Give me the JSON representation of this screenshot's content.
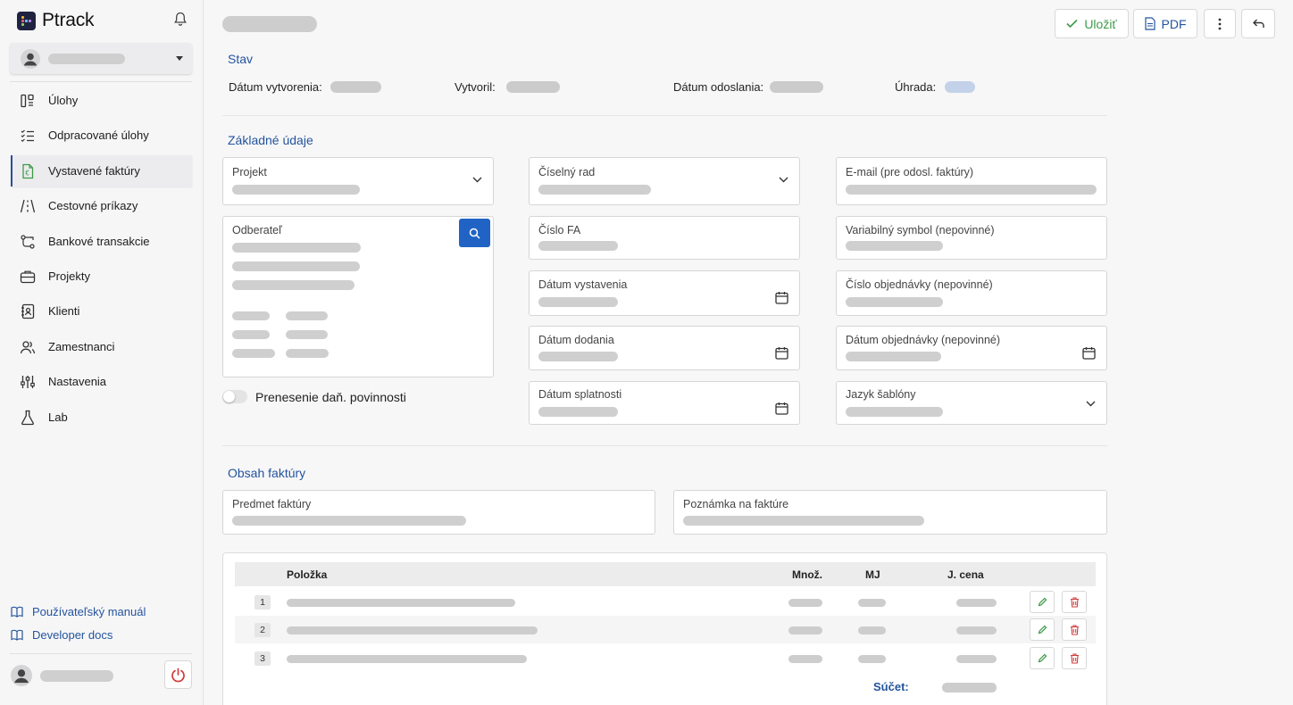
{
  "app": {
    "name": "Ptrack"
  },
  "sidebar": {
    "items": [
      {
        "label": "Úlohy",
        "icon": "tasks-icon"
      },
      {
        "label": "Odpracované úlohy",
        "icon": "checklist-icon"
      },
      {
        "label": "Vystavené faktúry",
        "icon": "invoice-icon",
        "active": true
      },
      {
        "label": "Cestovné príkazy",
        "icon": "road-icon"
      },
      {
        "label": "Bankové transakcie",
        "icon": "transactions-icon"
      },
      {
        "label": "Projekty",
        "icon": "briefcase-icon"
      },
      {
        "label": "Klienti",
        "icon": "contacts-icon"
      },
      {
        "label": "Zamestnanci",
        "icon": "users-icon"
      },
      {
        "label": "Nastavenia",
        "icon": "sliders-icon"
      },
      {
        "label": "Lab",
        "icon": "flask-icon"
      }
    ],
    "footer_links": [
      "Používateľský manuál",
      "Developer docs"
    ]
  },
  "toolbar": {
    "save_label": "Uložiť",
    "pdf_label": "PDF"
  },
  "status": {
    "title": "Stav",
    "created_label": "Dátum vytvorenia:",
    "created_by_label": "Vytvoril:",
    "sent_label": "Dátum odoslania:",
    "payment_label": "Úhrada:"
  },
  "basic": {
    "title": "Základné údaje",
    "project": "Projekt",
    "customer": "Odberateľ",
    "reverse_charge": "Prenesenie daň. povinnosti",
    "number_series": "Číselný rad",
    "invoice_number": "Číslo FA",
    "issue_date": "Dátum vystavenia",
    "delivery_date": "Dátum dodania",
    "due_date": "Dátum splatnosti",
    "email": "E-mail (pre odosl. faktúry)",
    "variable_symbol": "Variabilný symbol (nepovinné)",
    "order_number": "Číslo objednávky (nepovinné)",
    "order_date": "Dátum objednávky (nepovinné)",
    "template_language": "Jazyk šablóny"
  },
  "content": {
    "title": "Obsah faktúry",
    "subject": "Predmet faktúry",
    "note": "Poznámka na faktúre"
  },
  "table": {
    "columns": [
      "Položka",
      "Množ.",
      "MJ",
      "J. cena"
    ],
    "rows": [
      "1",
      "2",
      "3"
    ],
    "sum_label": "Súčet:"
  },
  "colors": {
    "accent": "#24549c",
    "primary_button": "#2163c4",
    "save_green": "#3f9a4a",
    "danger": "#d33b3b"
  }
}
